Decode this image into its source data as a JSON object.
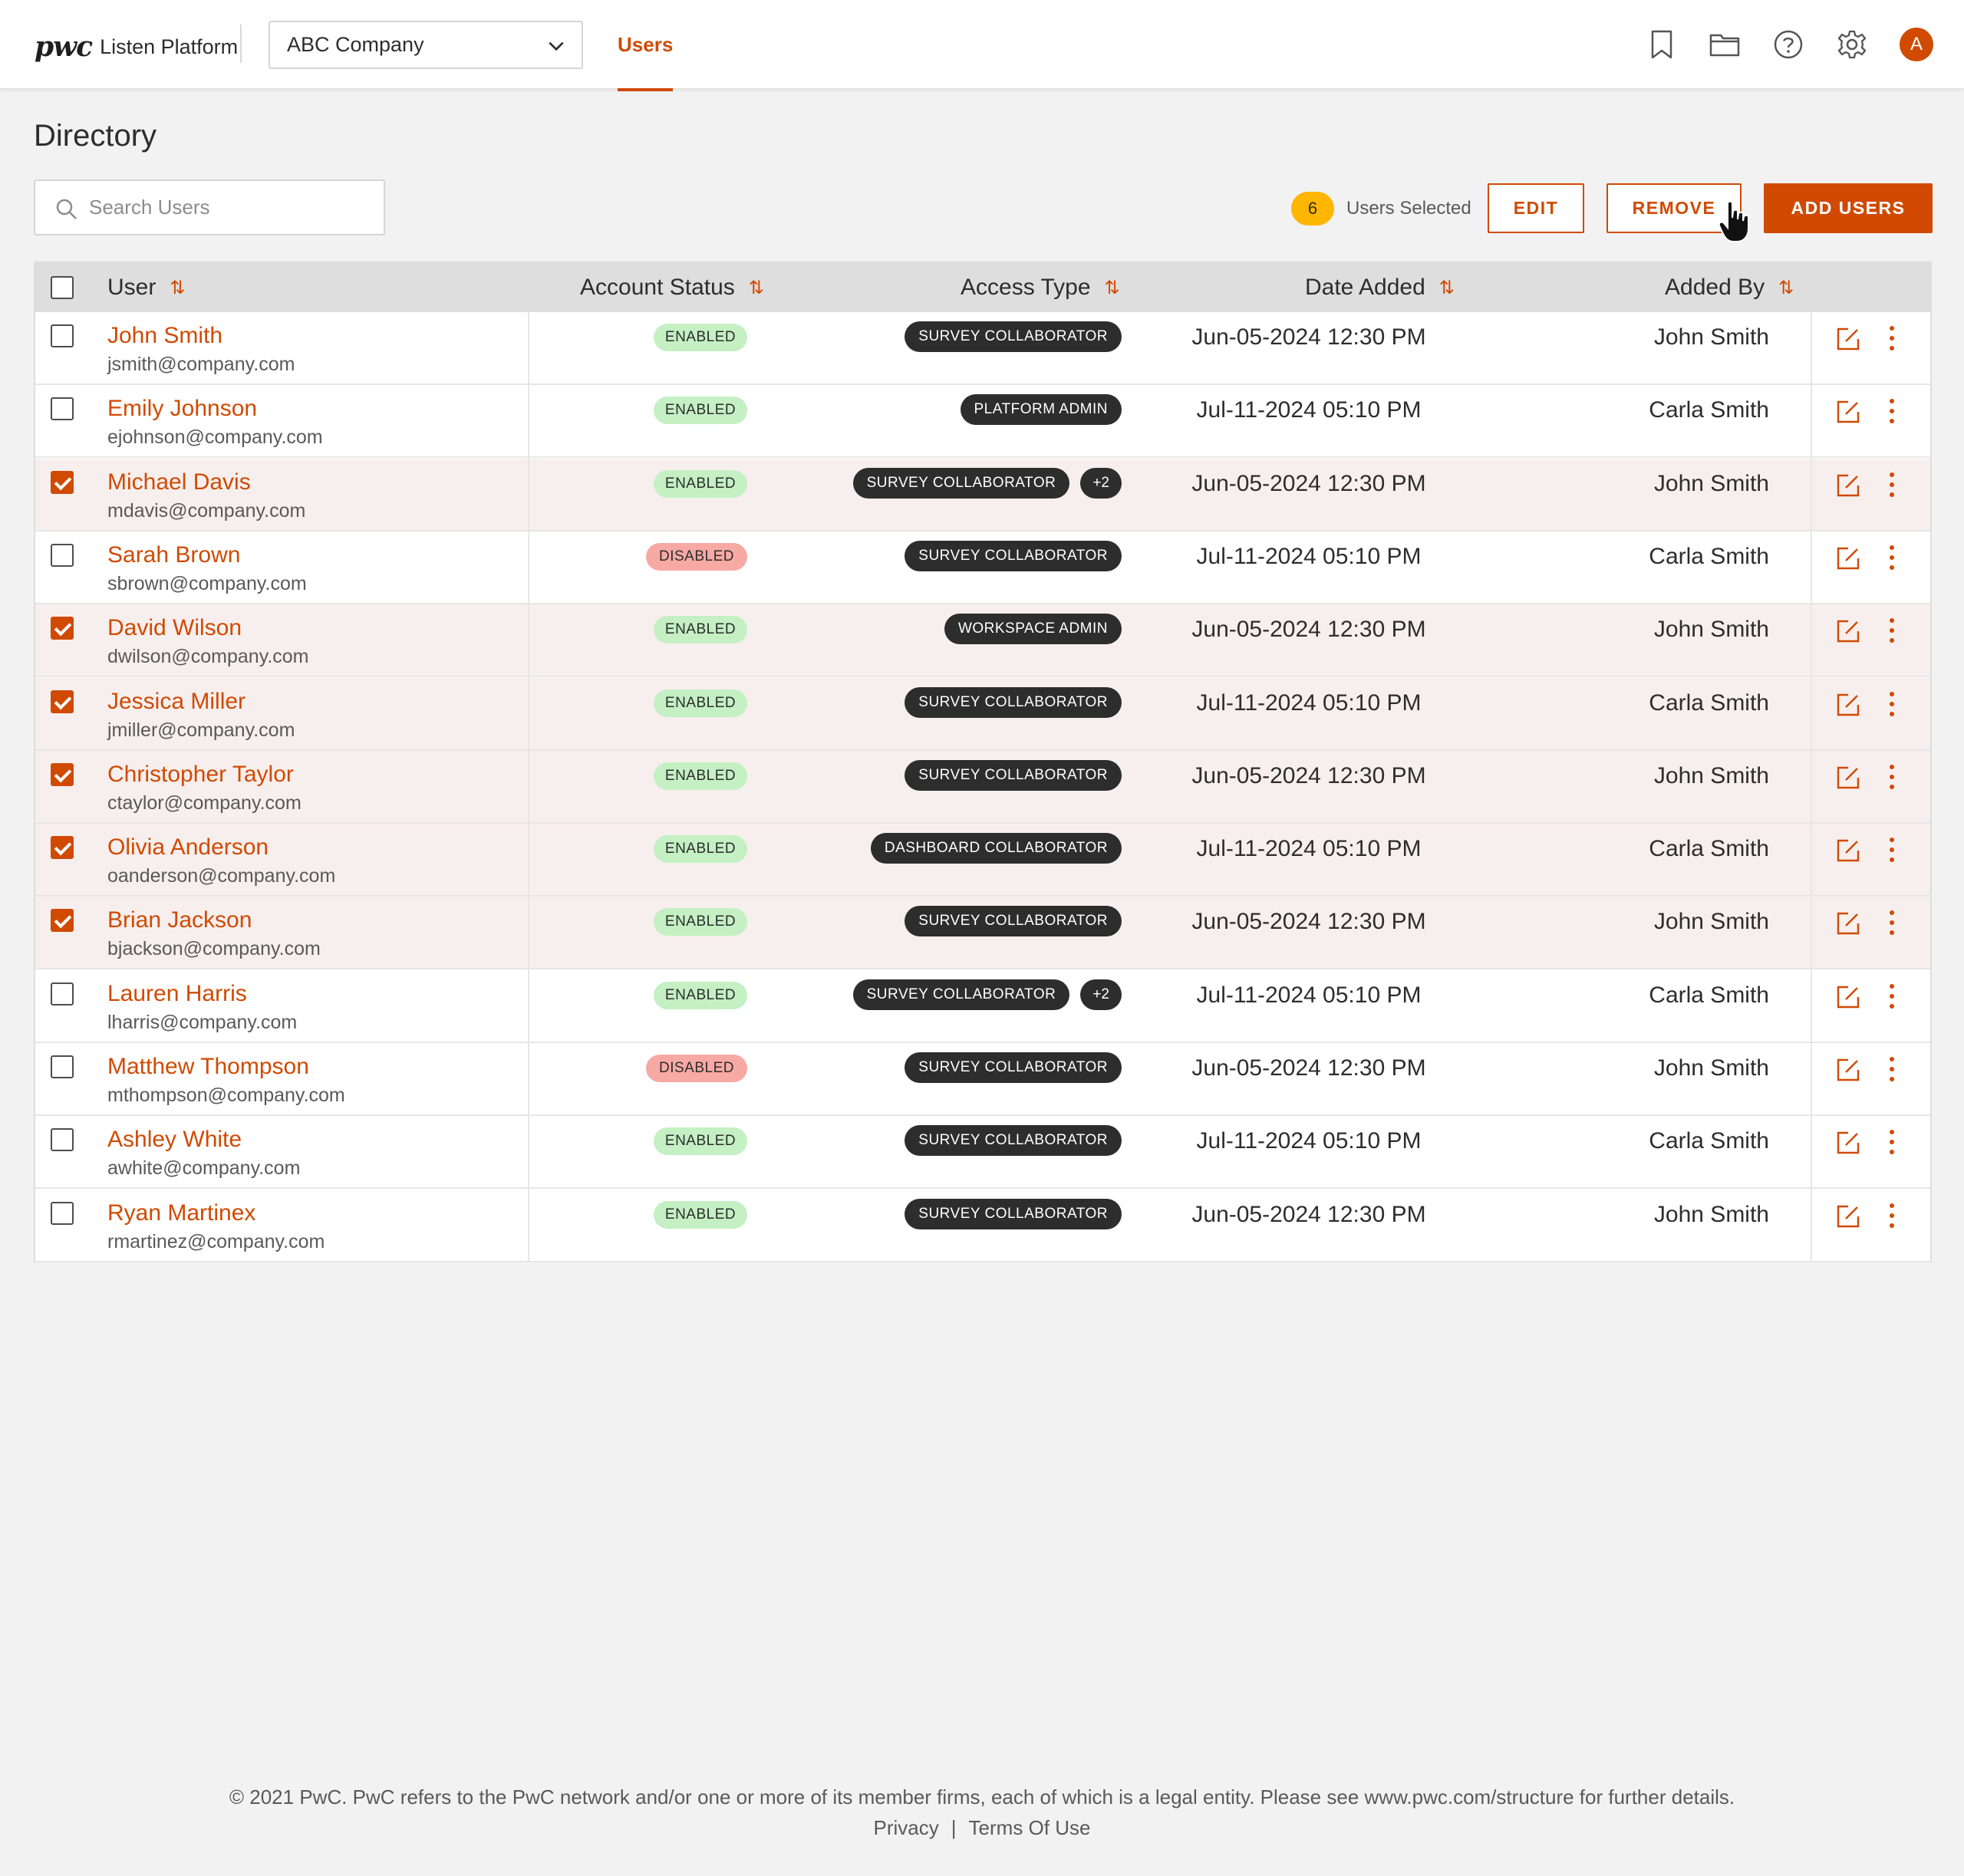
{
  "header": {
    "logo_mark": "pwc",
    "logo_text": "Listen Platform",
    "company_select": "ABC Company",
    "nav_tab": "Users",
    "icons": [
      "bookmark-icon",
      "folder-icon",
      "help-icon",
      "settings-icon"
    ],
    "avatar_initial": "A"
  },
  "page": {
    "title": "Directory",
    "search_placeholder": "Search Users",
    "selected_count": "6",
    "selected_label": "Users Selected",
    "edit_label": "EDIT",
    "remove_label": "REMOVE",
    "add_users_label": "ADD USERS"
  },
  "table": {
    "columns": [
      "User",
      "Account Status",
      "Access Type",
      "Date Added",
      "Added By"
    ],
    "rows": [
      {
        "name": "John Smith",
        "email": "jsmith@company.com",
        "status": "ENABLED",
        "access": "SURVEY COLLABORATOR",
        "extra": "",
        "date": "Jun-05-2024 12:30 PM",
        "added_by": "John Smith",
        "selected": false
      },
      {
        "name": "Emily Johnson",
        "email": "ejohnson@company.com",
        "status": "ENABLED",
        "access": "PLATFORM ADMIN",
        "extra": "",
        "date": "Jul-11-2024 05:10 PM",
        "added_by": "Carla Smith",
        "selected": false
      },
      {
        "name": "Michael Davis",
        "email": "mdavis@company.com",
        "status": "ENABLED",
        "access": "SURVEY COLLABORATOR",
        "extra": "+2",
        "date": "Jun-05-2024 12:30 PM",
        "added_by": "John Smith",
        "selected": true
      },
      {
        "name": "Sarah Brown",
        "email": "sbrown@company.com",
        "status": "DISABLED",
        "access": "SURVEY COLLABORATOR",
        "extra": "",
        "date": "Jul-11-2024 05:10 PM",
        "added_by": "Carla Smith",
        "selected": false
      },
      {
        "name": "David Wilson",
        "email": "dwilson@company.com",
        "status": "ENABLED",
        "access": "WORKSPACE ADMIN",
        "extra": "",
        "date": "Jun-05-2024 12:30 PM",
        "added_by": "John Smith",
        "selected": true
      },
      {
        "name": "Jessica Miller",
        "email": "jmiller@company.com",
        "status": "ENABLED",
        "access": "SURVEY COLLABORATOR",
        "extra": "",
        "date": "Jul-11-2024 05:10 PM",
        "added_by": "Carla Smith",
        "selected": true
      },
      {
        "name": "Christopher Taylor",
        "email": "ctaylor@company.com",
        "status": "ENABLED",
        "access": "SURVEY COLLABORATOR",
        "extra": "",
        "date": "Jun-05-2024 12:30 PM",
        "added_by": "John Smith",
        "selected": true
      },
      {
        "name": "Olivia Anderson",
        "email": "oanderson@company.com",
        "status": "ENABLED",
        "access": "DASHBOARD COLLABORATOR",
        "extra": "",
        "date": "Jul-11-2024 05:10 PM",
        "added_by": "Carla Smith",
        "selected": true
      },
      {
        "name": "Brian Jackson",
        "email": "bjackson@company.com",
        "status": "ENABLED",
        "access": "SURVEY COLLABORATOR",
        "extra": "",
        "date": "Jun-05-2024 12:30 PM",
        "added_by": "John Smith",
        "selected": true
      },
      {
        "name": "Lauren Harris",
        "email": "lharris@company.com",
        "status": "ENABLED",
        "access": "SURVEY COLLABORATOR",
        "extra": "+2",
        "date": "Jul-11-2024 05:10 PM",
        "added_by": "Carla Smith",
        "selected": false
      },
      {
        "name": "Matthew Thompson",
        "email": "mthompson@company.com",
        "status": "DISABLED",
        "access": "SURVEY COLLABORATOR",
        "extra": "",
        "date": "Jun-05-2024 12:30 PM",
        "added_by": "John Smith",
        "selected": false
      },
      {
        "name": "Ashley White",
        "email": "awhite@company.com",
        "status": "ENABLED",
        "access": "SURVEY COLLABORATOR",
        "extra": "",
        "date": "Jul-11-2024 05:10 PM",
        "added_by": "Carla Smith",
        "selected": false
      },
      {
        "name": "Ryan Martinex",
        "email": "rmartinez@company.com",
        "status": "ENABLED",
        "access": "SURVEY COLLABORATOR",
        "extra": "",
        "date": "Jun-05-2024 12:30 PM",
        "added_by": "John Smith",
        "selected": false
      }
    ]
  },
  "footer": {
    "copyright": "© 2021 PwC. PwC refers to the PwC network and/or one or more of its member firms, each of which is a legal entity. Please see www.pwc.com/structure for further details.",
    "privacy": "Privacy",
    "separator": "|",
    "terms": "Terms Of Use"
  },
  "colors": {
    "accent": "#d04a02",
    "badge": "#ffb600",
    "enabled": "#c4f0c3",
    "disabled": "#f7a9a4",
    "pill": "#2d2d2d",
    "selected_row": "#f7efee"
  }
}
